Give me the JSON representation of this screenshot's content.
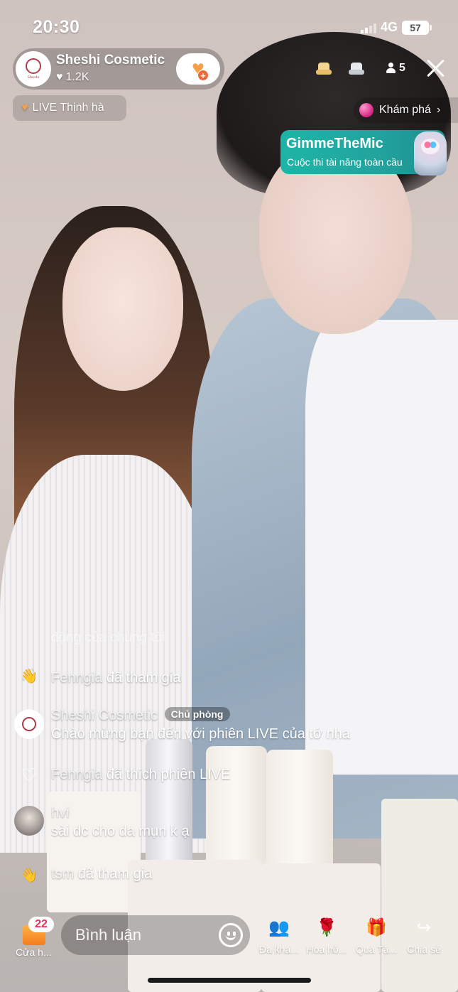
{
  "status_bar": {
    "time": "20:30",
    "network": "4G",
    "battery": "57"
  },
  "host": {
    "name": "Sheshi Cosmetic",
    "likes": "1.2K"
  },
  "top_right": {
    "viewer_count": "5"
  },
  "live_tag": {
    "text": "LIVE Thịnh hà"
  },
  "explore": {
    "label": "Khám phá"
  },
  "promo": {
    "title": "GimmeTheMic",
    "subtitle": "Cuộc thi tài năng toàn cầu"
  },
  "overlay_text": "động của chúng tôi.",
  "chat": [
    {
      "user": "Fenngia",
      "text": "đã tham gia",
      "icon": "wave-icon"
    },
    {
      "user": "Sheshi Cosmetic",
      "badge": "Chủ phòng",
      "text": "Chào mừng bạn đến với phiên LIVE của tớ nha",
      "icon": "avatar"
    },
    {
      "user": "Fenngia",
      "text": "đã thích phiên LIVE",
      "icon": "heart-outline-icon"
    },
    {
      "user": "hvi",
      "text": "sài dc cho da mụn k ạ",
      "icon": "avatar"
    },
    {
      "user": "tsm",
      "text": "đã tham gia",
      "icon": "wave-icon"
    }
  ],
  "bottom": {
    "shop_count": "22",
    "shop_label": "Cửa h...",
    "comment_placeholder": "Bình luận",
    "actions": [
      {
        "label": "Đa khá...",
        "icon": "multi-guest-icon"
      },
      {
        "label": "Hoa hồ...",
        "icon": "rose-icon"
      },
      {
        "label": "Quà Tặ...",
        "icon": "gift-icon"
      },
      {
        "label": "Chia sẻ",
        "icon": "share-icon"
      }
    ]
  },
  "colors": {
    "accent_orange": "#f5a04a",
    "promo_teal": "#1db5a7",
    "explore_pink": "#e0338f"
  }
}
